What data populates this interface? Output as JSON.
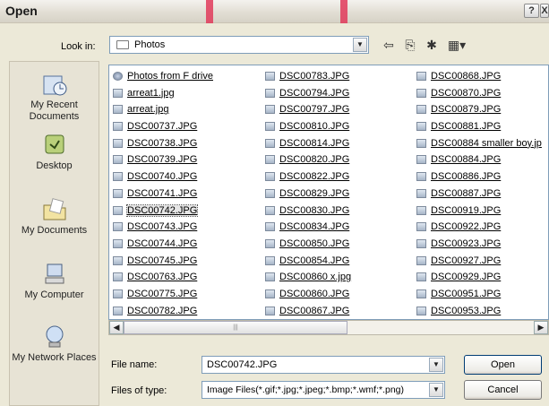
{
  "window": {
    "title": "Open"
  },
  "title_buttons": {
    "help": "?",
    "close": "X"
  },
  "look_in": {
    "label": "Look in:",
    "value": "Photos"
  },
  "places": [
    {
      "label": "My Recent Documents"
    },
    {
      "label": "Desktop"
    },
    {
      "label": "My Documents"
    },
    {
      "label": "My Computer"
    },
    {
      "label": "My Network Places"
    }
  ],
  "files": {
    "col1": [
      "Photos from F drive",
      "arreat1.jpg",
      "arreat.jpg",
      "DSC00737.JPG",
      "DSC00738.JPG",
      "DSC00739.JPG",
      "DSC00740.JPG",
      "DSC00741.JPG",
      "DSC00742.JPG",
      "DSC00743.JPG",
      "DSC00744.JPG",
      "DSC00745.JPG",
      "DSC00763.JPG",
      "DSC00775.JPG",
      "DSC00782.JPG"
    ],
    "col2": [
      "DSC00783.JPG",
      "DSC00794.JPG",
      "DSC00797.JPG",
      "DSC00810.JPG",
      "DSC00814.JPG",
      "DSC00820.JPG",
      "DSC00822.JPG",
      "DSC00829.JPG",
      "DSC00830.JPG",
      "DSC00834.JPG",
      "DSC00850.JPG",
      "DSC00854.JPG",
      "DSC00860 x.jpg",
      "DSC00860.JPG",
      "DSC00867.JPG"
    ],
    "col3": [
      "DSC00868.JPG",
      "DSC00870.JPG",
      "DSC00879.JPG",
      "DSC00881.JPG",
      "DSC00884 smaller boy.jp",
      "DSC00884.JPG",
      "DSC00886.JPG",
      "DSC00887.JPG",
      "DSC00919.JPG",
      "DSC00922.JPG",
      "DSC00923.JPG",
      "DSC00927.JPG",
      "DSC00929.JPG",
      "DSC00951.JPG",
      "DSC00953.JPG"
    ],
    "selected": "DSC00742.JPG"
  },
  "file_name": {
    "label": "File name:",
    "value": "DSC00742.JPG"
  },
  "file_type": {
    "label": "Files of type:",
    "value": "Image Files(*.gif;*.jpg;*.jpeg;*.bmp;*.wmf;*.png)"
  },
  "buttons": {
    "open": "Open",
    "cancel": "Cancel"
  }
}
